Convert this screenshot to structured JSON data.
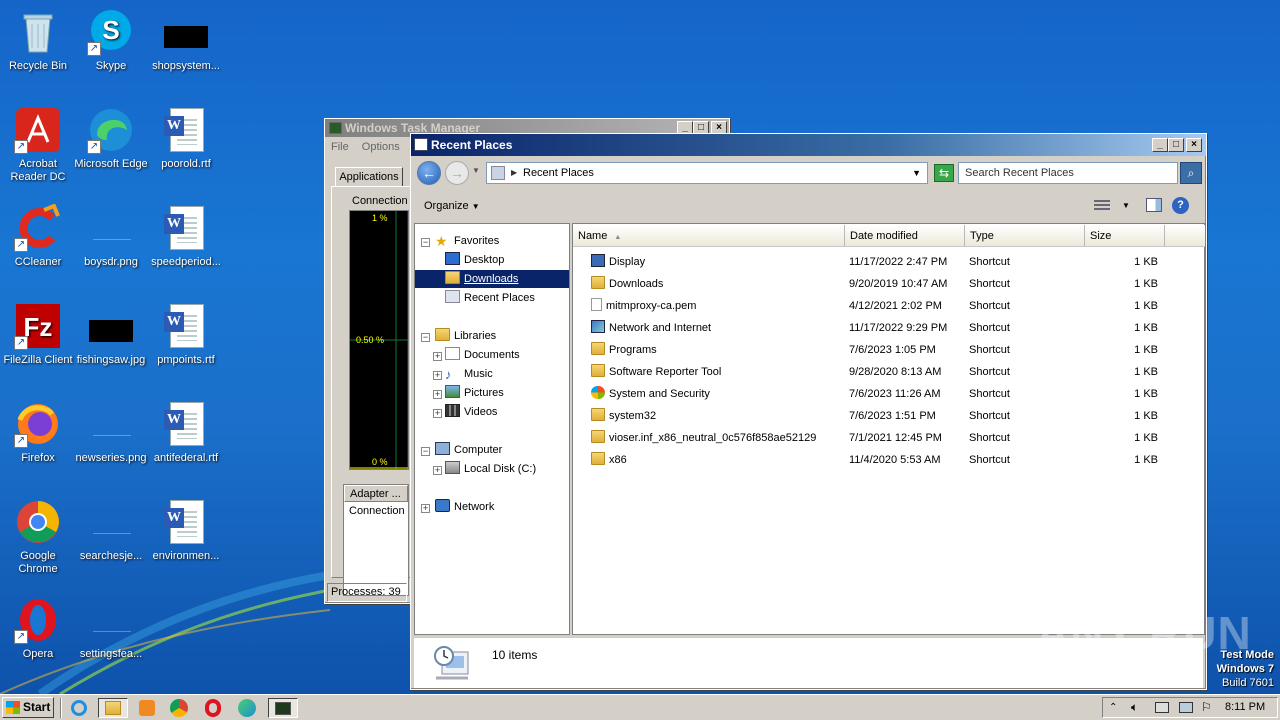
{
  "desktop": {
    "icons": [
      {
        "label": "Recycle Bin",
        "icon": "recycle-bin-icon"
      },
      {
        "label": "Skype",
        "icon": "skype-icon"
      },
      {
        "label": "shopsystem...",
        "icon": "black-image-icon"
      },
      {
        "label": "Acrobat Reader DC",
        "icon": "acrobat-icon"
      },
      {
        "label": "Microsoft Edge",
        "icon": "edge-icon"
      },
      {
        "label": "poorold.rtf",
        "icon": "word-doc-icon"
      },
      {
        "label": "CCleaner",
        "icon": "ccleaner-icon"
      },
      {
        "label": "boysdr.png",
        "icon": "blank-image-icon"
      },
      {
        "label": "speedperiod...",
        "icon": "word-doc-icon"
      },
      {
        "label": "FileZilla Client",
        "icon": "filezilla-icon"
      },
      {
        "label": "fishingsaw.jpg",
        "icon": "black-image-icon"
      },
      {
        "label": "pmpoints.rtf",
        "icon": "word-doc-icon"
      },
      {
        "label": "Firefox",
        "icon": "firefox-icon"
      },
      {
        "label": "newseries.png",
        "icon": "blank-image-icon"
      },
      {
        "label": "antifederal.rtf",
        "icon": "word-doc-icon"
      },
      {
        "label": "Google Chrome",
        "icon": "chrome-icon"
      },
      {
        "label": "searchesje...",
        "icon": "blank-image-icon"
      },
      {
        "label": "environmen...",
        "icon": "word-doc-icon"
      },
      {
        "label": "Opera",
        "icon": "opera-icon"
      },
      {
        "label": "settingsfea...",
        "icon": "blank-image-icon"
      }
    ]
  },
  "task_manager": {
    "title": "Windows Task Manager",
    "menu": [
      "File",
      "Options"
    ],
    "tab": "Applications",
    "graph_label": "Connection",
    "graph_ticks": [
      "1 %",
      "0.50 %",
      "0 %"
    ],
    "adapter_col": "Adapter ...",
    "adapter_row": "Connection",
    "status": "Processes: 39"
  },
  "explorer": {
    "title": "Recent Places",
    "address": "Recent Places",
    "search_placeholder": "Search Recent Places",
    "organize": "Organize",
    "nav": {
      "favorites": "Favorites",
      "desktop": "Desktop",
      "downloads": "Downloads",
      "recent": "Recent Places",
      "libraries": "Libraries",
      "documents": "Documents",
      "music": "Music",
      "pictures": "Pictures",
      "videos": "Videos",
      "computer": "Computer",
      "local_disk": "Local Disk (C:)",
      "network": "Network"
    },
    "columns": [
      "Name",
      "Date modified",
      "Type",
      "Size"
    ],
    "files": [
      {
        "name": "Display",
        "date": "11/17/2022 2:47 PM",
        "type": "Shortcut",
        "size": "1 KB",
        "icon": "display-icon"
      },
      {
        "name": "Downloads",
        "date": "9/20/2019 10:47 AM",
        "type": "Shortcut",
        "size": "1 KB",
        "icon": "downloads-folder-icon"
      },
      {
        "name": "mitmproxy-ca.pem",
        "date": "4/12/2021 2:02 PM",
        "type": "Shortcut",
        "size": "1 KB",
        "icon": "file-icon"
      },
      {
        "name": "Network and Internet",
        "date": "11/17/2022 9:29 PM",
        "type": "Shortcut",
        "size": "1 KB",
        "icon": "network-icon"
      },
      {
        "name": "Programs",
        "date": "7/6/2023 1:05 PM",
        "type": "Shortcut",
        "size": "1 KB",
        "icon": "programs-icon"
      },
      {
        "name": "Software Reporter Tool",
        "date": "9/28/2020 8:13 AM",
        "type": "Shortcut",
        "size": "1 KB",
        "icon": "folder-icon"
      },
      {
        "name": "System and Security",
        "date": "7/6/2023 11:26 AM",
        "type": "Shortcut",
        "size": "1 KB",
        "icon": "security-icon"
      },
      {
        "name": "system32",
        "date": "7/6/2023 1:51 PM",
        "type": "Shortcut",
        "size": "1 KB",
        "icon": "folder-icon"
      },
      {
        "name": "vioser.inf_x86_neutral_0c576f858ae52129",
        "date": "7/1/2021 12:45 PM",
        "type": "Shortcut",
        "size": "1 KB",
        "icon": "folder-icon"
      },
      {
        "name": "x86",
        "date": "11/4/2020 5:53 AM",
        "type": "Shortcut",
        "size": "1 KB",
        "icon": "folder-icon"
      }
    ],
    "item_count": "10 items"
  },
  "watermark": {
    "brand": "ANY RUN",
    "line1": "Test Mode",
    "line2": "Windows 7",
    "line3": "Build 7601"
  },
  "taskbar": {
    "start": "Start",
    "clock": "8:11 PM"
  }
}
